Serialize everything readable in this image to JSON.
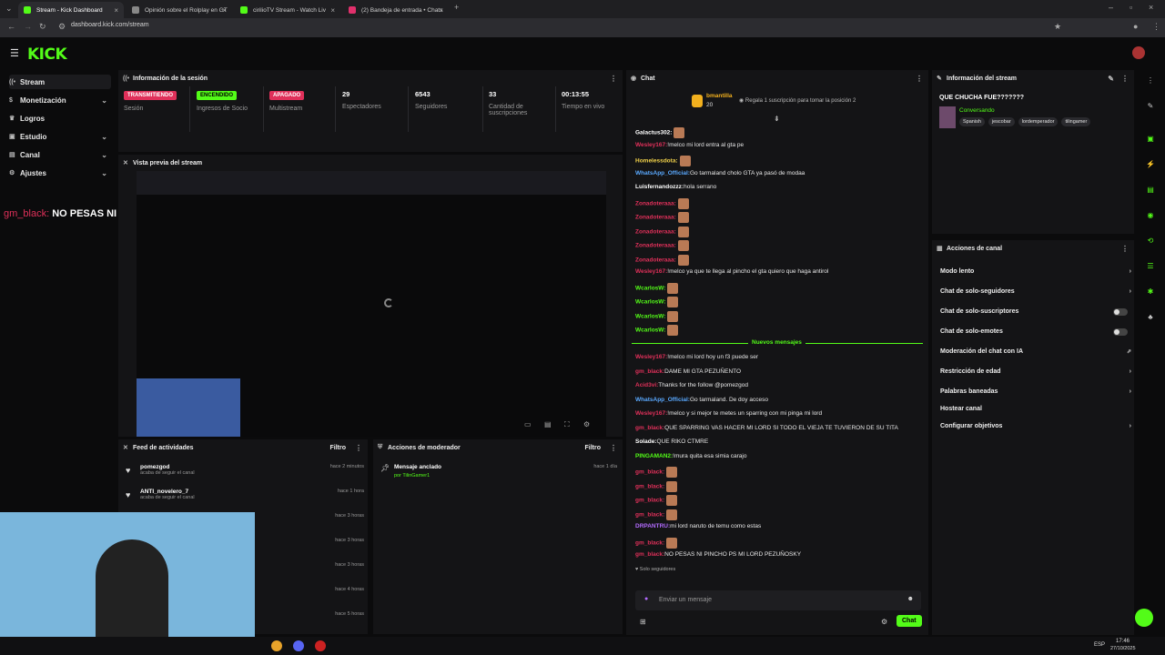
{
  "browser": {
    "tabs": [
      {
        "label": "Stream - Kick Dashboard",
        "color": "#53fc18"
      },
      {
        "label": "Opinión sobre el Rolplay en GT",
        "color": "#888888"
      },
      {
        "label": "cirilioTV Stream - Watch Liv",
        "color": "#53fc18"
      },
      {
        "label": "(2) Bandeja de entrada • Chats",
        "color": "#e1306c"
      }
    ],
    "url": "dashboard.kick.com/stream"
  },
  "logo": "KICK",
  "sidebar": {
    "items": [
      {
        "label": "Stream",
        "icon": "broadcast-icon"
      },
      {
        "label": "Monetización",
        "icon": "dollar-icon"
      },
      {
        "label": "Logros",
        "icon": "trophy-icon"
      },
      {
        "label": "Estudio",
        "icon": "studio-icon"
      },
      {
        "label": "Canal",
        "icon": "channel-icon"
      },
      {
        "label": "Ajustes",
        "icon": "gear-icon"
      }
    ]
  },
  "overlay_chat": {
    "user": "gm_black:",
    "text": "NO PESAS NI PINCHO PS MI LORD PEZUÑOSKY"
  },
  "session": {
    "title": "Información de la sesión",
    "cards": [
      {
        "badge": "TRANSMITIENDO",
        "label": "Sesión"
      },
      {
        "badge": "ENCENDIDO",
        "label": "Ingresos de Socio"
      },
      {
        "badge": "APAGADO",
        "label": "Multistream"
      },
      {
        "value": "29",
        "label": "Espectadores"
      },
      {
        "value": "6543",
        "label": "Seguidores"
      },
      {
        "value": "33",
        "label": "Cantidad de suscripciones"
      },
      {
        "value": "00:13:55",
        "label": "Tiempo en vivo"
      }
    ]
  },
  "preview": {
    "title": "Vista previa del stream"
  },
  "activity": {
    "title": "Feed de actividades",
    "filter": "Filtro",
    "items": [
      {
        "name": "pomezgod",
        "sub": "acaba de seguir el canal",
        "time": "hace 2 minutos"
      },
      {
        "name": "ANTI_novelero_7",
        "sub": "acaba de seguir el canal",
        "time": "hace 1 hora"
      },
      {
        "time": "hace 3 horas"
      },
      {
        "time": "hace 3 horas"
      },
      {
        "time": "hace 3 horas"
      },
      {
        "time": "hace 4 horas"
      },
      {
        "time": "hace 5 horas"
      }
    ]
  },
  "mod": {
    "title": "Acciones de moderador",
    "filter": "Filtro",
    "pinned_title": "Mensaje anclado",
    "pinned_by": "por TilinGamer1",
    "pinned_time": "hace 1 día"
  },
  "chat": {
    "title": "Chat",
    "gifter": "bmantilla",
    "gift_count": "20",
    "gift_text": "Regala 1 suscripción para tomar la posición 2",
    "new_messages": "Nuevos mensajes",
    "followers_only": "Solo seguidores",
    "input_placeholder": "Enviar un mensaje",
    "send": "Chat",
    "messages": [
      {
        "user": "Galactus302:",
        "color": "#ffffff",
        "text": "",
        "emote": true
      },
      {
        "user": "Wesley167:",
        "color": "#e0305a",
        "text": "!melco mi lord entra al gta pe"
      },
      {
        "user": "Homelessdota:",
        "color": "#f2d24a",
        "text": "",
        "emote": true
      },
      {
        "user": "WhatsApp_Official:",
        "color": "#5aa9ff",
        "text": "Go tarmaland cholo GTA ya pasó de modaa"
      },
      {
        "user": "Luisfernandozzz:",
        "color": "#ffffff",
        "text": "hola serrano"
      },
      {
        "user": "Zonadoteraaa:",
        "color": "#e0305a",
        "text": "",
        "emote": true
      },
      {
        "user": "Zonadoteraaa:",
        "color": "#e0305a",
        "text": "",
        "emote": true
      },
      {
        "user": "Zonadoteraaa:",
        "color": "#e0305a",
        "text": "",
        "emote": true
      },
      {
        "user": "Zonadoteraaa:",
        "color": "#e0305a",
        "text": "",
        "emote": true
      },
      {
        "user": "Zonadoteraaa:",
        "color": "#e0305a",
        "text": "",
        "emote": true
      },
      {
        "user": "Wesley167:",
        "color": "#e0305a",
        "text": "!melco ya que te llega al pincho el gta quiero que haga antirol"
      },
      {
        "user": "WcarlosW:",
        "color": "#53fc18",
        "text": "",
        "emote": true
      },
      {
        "user": "WcarlosW:",
        "color": "#53fc18",
        "text": "",
        "emote": true
      },
      {
        "user": "WcarlosW:",
        "color": "#53fc18",
        "text": "",
        "emote": true
      },
      {
        "user": "WcarlosW:",
        "color": "#53fc18",
        "text": "",
        "emote": true
      }
    ],
    "messages2": [
      {
        "user": "Wesley167:",
        "color": "#e0305a",
        "text": "!melco mi lord hoy un f3 puede ser"
      },
      {
        "user": "gm_black:",
        "color": "#e0305a",
        "text": "DAME MI GTA PEZUÑENTO"
      },
      {
        "user": "Acid3vi:",
        "color": "#e0305a",
        "text": "Thanks for the follow @pomezgod"
      },
      {
        "user": "WhatsApp_Official:",
        "color": "#5aa9ff",
        "text": "Go tarmaland. De doy acceso"
      },
      {
        "user": "Wesley167:",
        "color": "#e0305a",
        "text": "!melco y si mejor te metes un sparring con mi pinga mi lord"
      },
      {
        "user": "gm_black:",
        "color": "#e0305a",
        "text": "QUE SPARRING VAS HACER MI LORD SI TODO EL VIEJA TE TUVIERON DE SU TITA"
      },
      {
        "user": "Solade:",
        "color": "#ffffff",
        "text": "QUE RIKO CTMRE"
      },
      {
        "user": "PINGAMAN2:",
        "color": "#53fc18",
        "text": "!mura quita esa simia carajo"
      },
      {
        "user": "gm_black:",
        "color": "#e0305a",
        "text": "",
        "emote": true
      },
      {
        "user": "gm_black:",
        "color": "#e0305a",
        "text": "",
        "emote": true
      },
      {
        "user": "gm_black:",
        "color": "#e0305a",
        "text": "",
        "emote": true
      },
      {
        "user": "gm_black:",
        "color": "#e0305a",
        "text": "",
        "emote": true
      },
      {
        "user": "DRPANTRU:",
        "color": "#b36bff",
        "text": "mi lord naruto de temu como estas"
      },
      {
        "user": "gm_black:",
        "color": "#e0305a",
        "text": "",
        "emote": true
      },
      {
        "user": "gm_black:",
        "color": "#e0305a",
        "text": "NO PESAS NI PINCHO PS MI LORD PEZUÑOSKY"
      }
    ]
  },
  "stream_info": {
    "title": "Información del stream",
    "stream_title": "QUE CHUCHA FUE???????",
    "category": "Conversando",
    "tags": [
      "Spanish",
      "jescobar",
      "lordemperador",
      "tilingamer"
    ]
  },
  "channel_actions": {
    "title": "Acciones de canal",
    "items": [
      {
        "label": "Modo lento",
        "control": "chevron"
      },
      {
        "label": "Chat de solo-seguidores",
        "control": "chevron"
      },
      {
        "label": "Chat de solo-suscriptores",
        "control": "toggle"
      },
      {
        "label": "Chat de solo-emotes",
        "control": "toggle"
      },
      {
        "label": "Moderación del chat con IA",
        "control": "external"
      },
      {
        "label": "Restricción de edad",
        "control": "chevron"
      },
      {
        "label": "Palabras baneadas",
        "control": "chevron"
      },
      {
        "label": "Hostear canal",
        "control": "none"
      },
      {
        "label": "Configurar objetivos",
        "control": "chevron"
      }
    ]
  },
  "taskbar": {
    "lang": "ESP",
    "time": "17:46",
    "date": "27/10/2025"
  },
  "colors": {
    "accent": "#53fc18",
    "live": "#e0305a",
    "panel": "#141416"
  }
}
